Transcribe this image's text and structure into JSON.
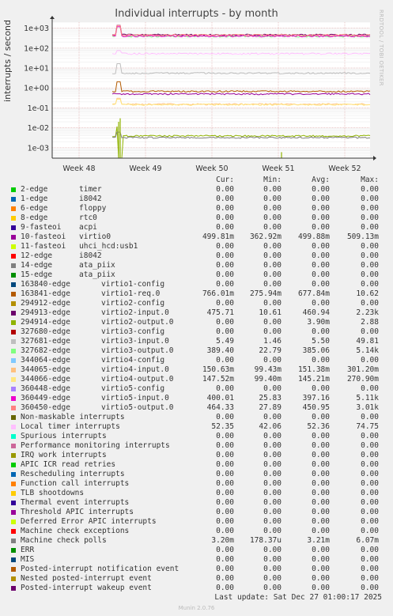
{
  "chart_data": {
    "type": "line",
    "title": "Individual interrupts - by month",
    "ylabel": "interrupts / second",
    "yscale": "log",
    "ylim": [
      0.0003,
      2000
    ],
    "yticks": [
      "1e+03",
      "1e+02",
      "1e+01",
      "1e+00",
      "1e-01",
      "1e-02",
      "1e-03"
    ],
    "xticks": [
      "Week 48",
      "Week 49",
      "Week 50",
      "Week 51",
      "Week 52"
    ],
    "side_text": "RRDTOOL / TOBI OETIKER",
    "columns": [
      "Cur:",
      "Min:",
      "Avg:",
      "Max:"
    ],
    "series": [
      {
        "name": "2-edge",
        "device": "timer",
        "color": "#00cc00",
        "cur": "0.00",
        "min": "0.00",
        "avg": "0.00",
        "max": "0.00"
      },
      {
        "name": "1-edge",
        "device": "i8042",
        "color": "#0066b3",
        "cur": "0.00",
        "min": "0.00",
        "avg": "0.00",
        "max": "0.00"
      },
      {
        "name": "6-edge",
        "device": "floppy",
        "color": "#ff8000",
        "cur": "0.00",
        "min": "0.00",
        "avg": "0.00",
        "max": "0.00"
      },
      {
        "name": "8-edge",
        "device": "rtc0",
        "color": "#ffcc00",
        "cur": "0.00",
        "min": "0.00",
        "avg": "0.00",
        "max": "0.00"
      },
      {
        "name": "9-fasteoi",
        "device": "acpi",
        "color": "#330099",
        "cur": "0.00",
        "min": "0.00",
        "avg": "0.00",
        "max": "0.00"
      },
      {
        "name": "10-fasteoi",
        "device": "virtio0",
        "color": "#990099",
        "cur": "499.81m",
        "min": "362.92m",
        "avg": "499.88m",
        "max": "509.13m"
      },
      {
        "name": "11-fasteoi",
        "device": "uhci_hcd:usb1",
        "color": "#ccff00",
        "cur": "0.00",
        "min": "0.00",
        "avg": "0.00",
        "max": "0.00"
      },
      {
        "name": "12-edge",
        "device": "i8042",
        "color": "#ff0000",
        "cur": "0.00",
        "min": "0.00",
        "avg": "0.00",
        "max": "0.00"
      },
      {
        "name": "14-edge",
        "device": "ata_piix",
        "color": "#808080",
        "cur": "0.00",
        "min": "0.00",
        "avg": "0.00",
        "max": "0.00"
      },
      {
        "name": "15-edge",
        "device": "ata_piix",
        "color": "#008f00",
        "cur": "0.00",
        "min": "0.00",
        "avg": "0.00",
        "max": "0.00"
      },
      {
        "name": "163840-edge",
        "device": "virtio1-config",
        "color": "#00487d",
        "cur": "0.00",
        "min": "0.00",
        "avg": "0.00",
        "max": "0.00"
      },
      {
        "name": "163841-edge",
        "device": "virtio1-req.0",
        "color": "#b35a00",
        "cur": "766.01m",
        "min": "275.94m",
        "avg": "677.84m",
        "max": "10.62"
      },
      {
        "name": "294912-edge",
        "device": "virtio2-config",
        "color": "#b38f00",
        "cur": "0.00",
        "min": "0.00",
        "avg": "0.00",
        "max": "0.00"
      },
      {
        "name": "294913-edge",
        "device": "virtio2-input.0",
        "color": "#6b006b",
        "cur": "475.71",
        "min": "10.61",
        "avg": "460.94",
        "max": "2.23k"
      },
      {
        "name": "294914-edge",
        "device": "virtio2-output.0",
        "color": "#8fb300",
        "cur": "0.00",
        "min": "0.00",
        "avg": "3.90m",
        "max": "2.88"
      },
      {
        "name": "327680-edge",
        "device": "virtio3-config",
        "color": "#b30000",
        "cur": "0.00",
        "min": "0.00",
        "avg": "0.00",
        "max": "0.00"
      },
      {
        "name": "327681-edge",
        "device": "virtio3-input.0",
        "color": "#bebebe",
        "cur": "5.49",
        "min": "1.46",
        "avg": "5.50",
        "max": "49.81"
      },
      {
        "name": "327682-edge",
        "device": "virtio3-output.0",
        "color": "#80ff80",
        "cur": "389.40",
        "min": "22.79",
        "avg": "385.06",
        "max": "5.14k"
      },
      {
        "name": "344064-edge",
        "device": "virtio4-config",
        "color": "#80c9ff",
        "cur": "0.00",
        "min": "0.00",
        "avg": "0.00",
        "max": "0.00"
      },
      {
        "name": "344065-edge",
        "device": "virtio4-input.0",
        "color": "#ffc080",
        "cur": "150.63m",
        "min": "99.43m",
        "avg": "151.38m",
        "max": "301.20m"
      },
      {
        "name": "344066-edge",
        "device": "virtio4-output.0",
        "color": "#ffe680",
        "cur": "147.52m",
        "min": "99.40m",
        "avg": "145.21m",
        "max": "270.90m"
      },
      {
        "name": "360448-edge",
        "device": "virtio5-config",
        "color": "#aa80ff",
        "cur": "0.00",
        "min": "0.00",
        "avg": "0.00",
        "max": "0.00"
      },
      {
        "name": "360449-edge",
        "device": "virtio5-input.0",
        "color": "#ee00cc",
        "cur": "400.01",
        "min": "25.83",
        "avg": "397.16",
        "max": "5.11k"
      },
      {
        "name": "360450-edge",
        "device": "virtio5-output.0",
        "color": "#ff8080",
        "cur": "464.33",
        "min": "27.89",
        "avg": "450.95",
        "max": "3.01k"
      },
      {
        "name": "Non-maskable interrupts",
        "device": "",
        "color": "#666600",
        "cur": "0.00",
        "min": "0.00",
        "avg": "0.00",
        "max": "0.00"
      },
      {
        "name": "Local timer interrupts",
        "device": "",
        "color": "#ffbfff",
        "cur": "52.35",
        "min": "42.06",
        "avg": "52.36",
        "max": "74.75"
      },
      {
        "name": "Spurious interrupts",
        "device": "",
        "color": "#00ffcc",
        "cur": "0.00",
        "min": "0.00",
        "avg": "0.00",
        "max": "0.00"
      },
      {
        "name": "Performance monitoring interrupts",
        "device": "",
        "color": "#cc6699",
        "cur": "0.00",
        "min": "0.00",
        "avg": "0.00",
        "max": "0.00"
      },
      {
        "name": "IRQ work interrupts",
        "device": "",
        "color": "#999900",
        "cur": "0.00",
        "min": "0.00",
        "avg": "0.00",
        "max": "0.00"
      },
      {
        "name": "APIC ICR read retries",
        "device": "",
        "color": "#00cc00",
        "cur": "0.00",
        "min": "0.00",
        "avg": "0.00",
        "max": "0.00"
      },
      {
        "name": "Rescheduling interrupts",
        "device": "",
        "color": "#0066b3",
        "cur": "0.00",
        "min": "0.00",
        "avg": "0.00",
        "max": "0.00"
      },
      {
        "name": "Function call interrupts",
        "device": "",
        "color": "#ff8000",
        "cur": "0.00",
        "min": "0.00",
        "avg": "0.00",
        "max": "0.00"
      },
      {
        "name": "TLB shootdowns",
        "device": "",
        "color": "#ffcc00",
        "cur": "0.00",
        "min": "0.00",
        "avg": "0.00",
        "max": "0.00"
      },
      {
        "name": "Thermal event interrupts",
        "device": "",
        "color": "#330099",
        "cur": "0.00",
        "min": "0.00",
        "avg": "0.00",
        "max": "0.00"
      },
      {
        "name": "Threshold APIC interrupts",
        "device": "",
        "color": "#990099",
        "cur": "0.00",
        "min": "0.00",
        "avg": "0.00",
        "max": "0.00"
      },
      {
        "name": "Deferred Error APIC interrupts",
        "device": "",
        "color": "#ccff00",
        "cur": "0.00",
        "min": "0.00",
        "avg": "0.00",
        "max": "0.00"
      },
      {
        "name": "Machine check exceptions",
        "device": "",
        "color": "#ff0000",
        "cur": "0.00",
        "min": "0.00",
        "avg": "0.00",
        "max": "0.00"
      },
      {
        "name": "Machine check polls",
        "device": "",
        "color": "#808080",
        "cur": "3.20m",
        "min": "178.37u",
        "avg": "3.21m",
        "max": "6.07m"
      },
      {
        "name": "ERR",
        "device": "",
        "color": "#008f00",
        "cur": "0.00",
        "min": "0.00",
        "avg": "0.00",
        "max": "0.00"
      },
      {
        "name": "MIS",
        "device": "",
        "color": "#00487d",
        "cur": "0.00",
        "min": "0.00",
        "avg": "0.00",
        "max": "0.00"
      },
      {
        "name": "Posted-interrupt notification event",
        "device": "",
        "color": "#b35a00",
        "cur": "0.00",
        "min": "0.00",
        "avg": "0.00",
        "max": "0.00"
      },
      {
        "name": "Nested posted-interrupt event",
        "device": "",
        "color": "#b38f00",
        "cur": "0.00",
        "min": "0.00",
        "avg": "0.00",
        "max": "0.00"
      },
      {
        "name": "Posted-interrupt wakeup event",
        "device": "",
        "color": "#6b006b",
        "cur": "0.00",
        "min": "0.00",
        "avg": "0.00",
        "max": "0.00"
      }
    ]
  },
  "last_update": "Last update: Sat Dec 27 01:00:17 2025",
  "footer": "Munin 2.0.76"
}
